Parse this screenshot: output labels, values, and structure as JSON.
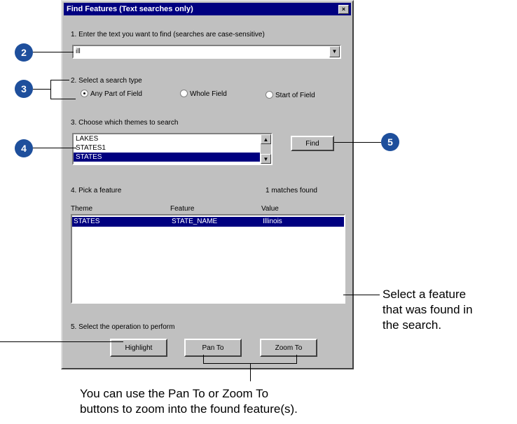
{
  "dialog": {
    "title": "Find Features (Text searches only)",
    "close_glyph": "×",
    "step1_label": "1. Enter the text you want to find (searches are case-sensitive)",
    "search_text": "ill",
    "step2_label": "2. Select a search type",
    "radios": [
      {
        "label": "Any Part of Field",
        "selected": true
      },
      {
        "label": "Whole Field",
        "selected": false
      },
      {
        "label": "Start of Field",
        "selected": false
      }
    ],
    "step3_label": "3. Choose which themes to search",
    "themes": [
      "LAKES",
      "STATES1",
      "STATES"
    ],
    "find_button": "Find",
    "step4_label": "4. Pick a feature",
    "matches_label": "1 matches found",
    "columns": [
      "Theme",
      "Feature",
      "Value"
    ],
    "results": [
      {
        "theme": "STATES",
        "feature": "STATE_NAME",
        "value": "Illinois"
      }
    ],
    "step5_label": "5. Select the operation to perform",
    "buttons": [
      "Highlight",
      "Pan To",
      "Zoom To"
    ]
  },
  "callouts": [
    "2",
    "3",
    "4",
    "5"
  ],
  "captions": {
    "right": [
      "Select a feature",
      "that was found in",
      "the search."
    ],
    "bottom": [
      "You can use the Pan To or Zoom To",
      "buttons to zoom into the found feature(s)."
    ]
  },
  "colors": {
    "dialog_bg": "#c0c0c0",
    "titlebar": "#000080",
    "selection": "#000080",
    "callout": "#1e4f9c"
  }
}
